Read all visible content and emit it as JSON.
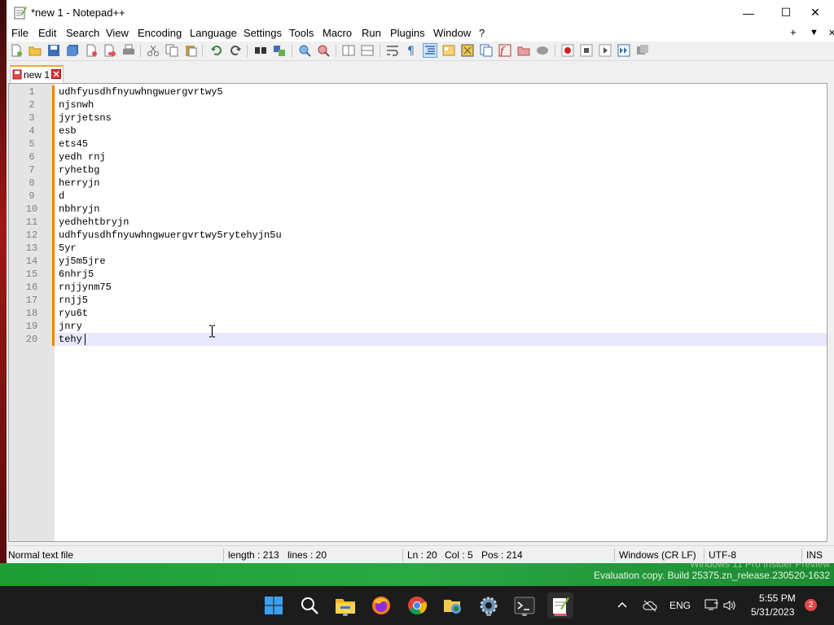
{
  "window": {
    "title": "*new 1 - Notepad++",
    "minimize": "—",
    "maximize": "☐",
    "close": "✕"
  },
  "menu": {
    "items": [
      "File",
      "Edit",
      "Search",
      "View",
      "Encoding",
      "Language",
      "Settings",
      "Tools",
      "Macro",
      "Run",
      "Plugins",
      "Window",
      "?"
    ],
    "add": "+",
    "list": "▼",
    "close": "✕"
  },
  "tab": {
    "label": "new 1",
    "close_icon": "close-tab-icon"
  },
  "editor": {
    "lines": [
      "udhfyusdhfnyuwhngwuergvrtwy5",
      "njsnwh",
      "jyrjetsns",
      "esb",
      "ets45",
      "yedh rnj",
      "ryhetbg",
      "herryjn",
      "d",
      "nbhryjn",
      "yedhehtbryjn",
      "udhfyusdhfnyuwhngwuergvrtwy5rytehyjn5u",
      "5yr",
      "yj5m5jre",
      "6nhrj5",
      "rnjjynm75",
      "rnjj5",
      "ryu6t",
      "jnry",
      "tehy"
    ],
    "current_line": 20
  },
  "status": {
    "file_type": "Normal text file",
    "length": "length : 213",
    "lines": "lines : 20",
    "ln": "Ln : 20",
    "col": "Col : 5",
    "pos": "Pos : 214",
    "eol": "Windows (CR LF)",
    "encoding": "UTF-8",
    "mode": "INS"
  },
  "desktop": {
    "watermark_line1": "Windows 11 Pro Insider Preview",
    "watermark_line2": "Evaluation copy. Build 25375.zn_release.230520-1632"
  },
  "taskbar": {
    "apps": [
      "start-icon",
      "search-icon",
      "file-explorer-icon",
      "firefox-icon",
      "chrome-icon",
      "file-share-icon",
      "settings-icon",
      "terminal-icon",
      "notepadpp-icon"
    ],
    "language": "ENG",
    "time": "5:55 PM",
    "date": "5/31/2023",
    "notification_count": "2"
  },
  "colors": {
    "change_marker": "#ff8000",
    "tab_accent": "#f8a628",
    "current_line_bg": "#e8e8ff"
  }
}
